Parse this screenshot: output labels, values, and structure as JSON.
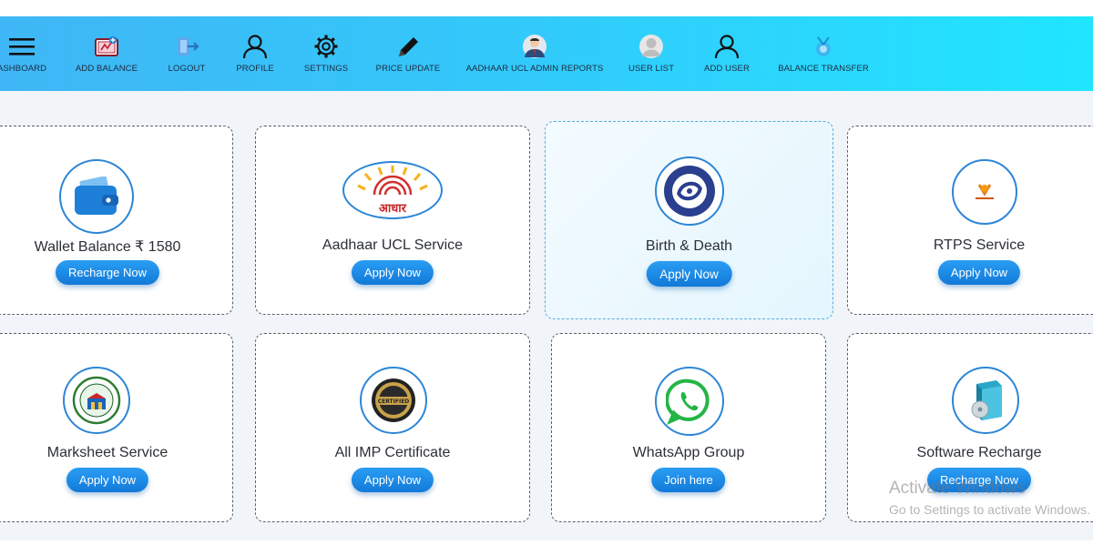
{
  "nav": {
    "items": [
      {
        "label": "ASHBOARD",
        "icon": "menu-icon"
      },
      {
        "label": "ADD BALANCE",
        "icon": "wallet-add-icon"
      },
      {
        "label": "LOGOUT",
        "icon": "logout-icon"
      },
      {
        "label": "PROFILE",
        "icon": "user-icon"
      },
      {
        "label": "SETTINGS",
        "icon": "gear-icon"
      },
      {
        "label": "PRICE UPDATE",
        "icon": "pencil-icon"
      },
      {
        "label": "AADHAAR UCL ADMIN REPORTS",
        "icon": "admin-avatar-icon"
      },
      {
        "label": "USER LIST",
        "icon": "user-avatar-icon"
      },
      {
        "label": "ADD USER",
        "icon": "add-user-icon"
      },
      {
        "label": "BALANCE TRANSFER",
        "icon": "transfer-icon"
      }
    ]
  },
  "cards": [
    {
      "title": "Wallet Balance ₹ 1580",
      "button": "Recharge Now",
      "icon": "wallet-icon"
    },
    {
      "title": "Aadhaar UCL Service",
      "button": "Apply Now",
      "icon": "aadhaar-logo-icon",
      "logo_text": "आधार"
    },
    {
      "title": "Birth & Death",
      "button": "Apply Now",
      "icon": "crs-emblem-icon"
    },
    {
      "title": "RTPS Service",
      "button": "Apply Now",
      "icon": "rtps-logo-icon"
    },
    {
      "title": "Marksheet Service",
      "button": "Apply Now",
      "icon": "education-board-icon"
    },
    {
      "title": "All IMP Certificate",
      "button": "Apply Now",
      "icon": "certified-badge-icon",
      "logo_text": "CERTIFIED"
    },
    {
      "title": "WhatsApp Group",
      "button": "Join here",
      "icon": "whatsapp-icon"
    },
    {
      "title": "Software Recharge",
      "button": "Recharge Now",
      "icon": "software-box-icon"
    }
  ],
  "watermark": {
    "line1": "Activate Windows",
    "line2": "Go to Settings to activate Windows."
  },
  "colors": {
    "accent": "#1a86e0",
    "nav_start": "#3fb6f5",
    "nav_end": "#1fe6ff"
  }
}
